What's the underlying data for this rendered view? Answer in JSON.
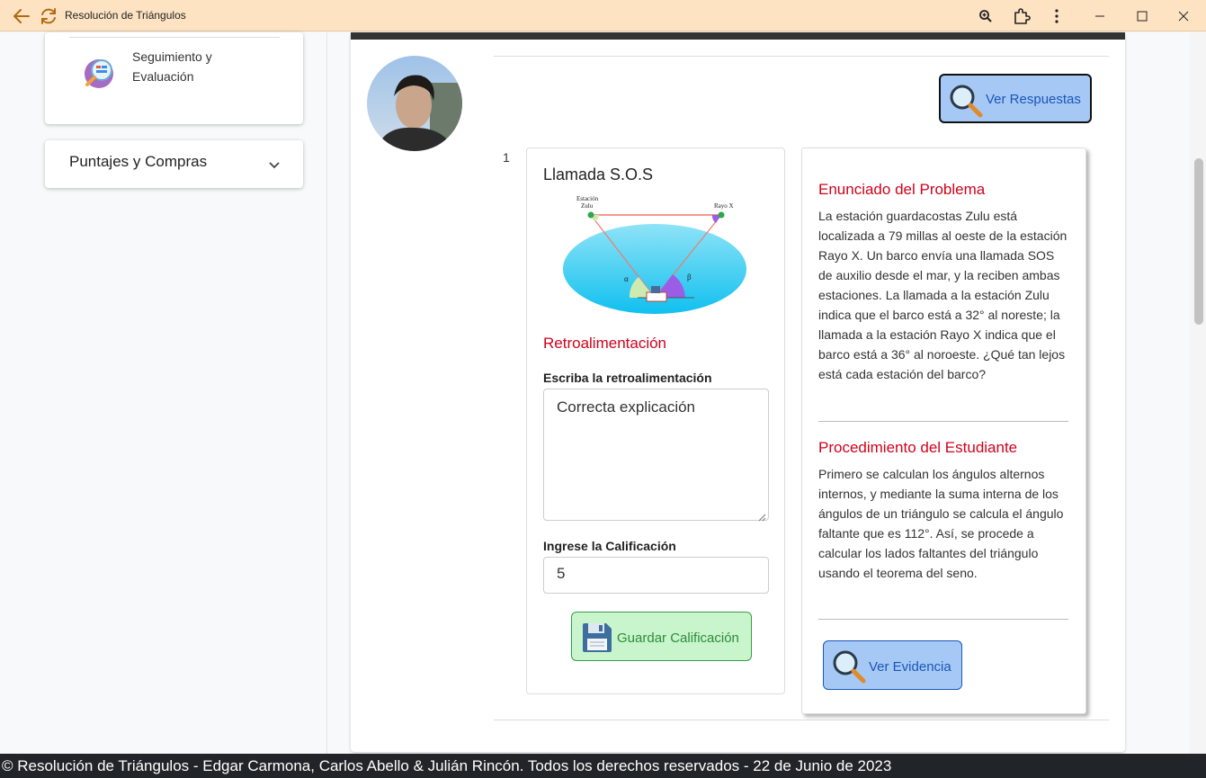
{
  "window": {
    "title": "Resolución de Triángulos",
    "back_icon": "arrow-left-icon",
    "refresh_icon": "refresh-icon",
    "zoom_icon": "zoom-icon",
    "extensions_icon": "puzzle-icon",
    "more_icon": "more-vertical-icon"
  },
  "sidebar": {
    "items": [
      {
        "label": "Seguimiento y Evaluación",
        "icon": "magnifier-chart-icon"
      }
    ],
    "accordion": {
      "label": "Puntajes y Compras",
      "expanded": false
    }
  },
  "main": {
    "ver_respuestas_label": "Ver Respuestas",
    "row_number": "1",
    "problem": {
      "title": "Llamada S.O.S",
      "diagram": {
        "left_station": "Estación Zulu",
        "right_station": "Rayo X",
        "alpha": "α",
        "beta": "β"
      }
    },
    "feedback": {
      "section_title": "Retroalimentación",
      "write_label": "Escriba la retroalimentación",
      "text": "Correcta explicación",
      "grade_label": "Ingrese la Calificación",
      "grade_value": "5",
      "save_label": "Guardar Calificación"
    },
    "statement": {
      "title": "Enunciado del Problema",
      "text": "La estación guardacostas Zulu está localizada a 79 millas al oeste de la estación Rayo X. Un barco envía una llamada SOS de auxilio desde el mar, y la reciben ambas estaciones. La llamada a la estación Zulu indica que el barco está a 32° al noreste; la llamada a la estación Rayo X indica que el barco está a 36° al noroeste. ¿Qué tan lejos está cada estación del barco?"
    },
    "procedure": {
      "title": "Procedimiento del Estudiante",
      "text": "Primero se calculan los ángulos alternos internos, y mediante la suma interna de los ángulos de un triángulo se calcula el ángulo faltante que es 112°. Así, se procede a calcular los lados faltantes del triángulo usando el teorema del seno."
    },
    "ver_evidencia_label": "Ver Evidencia"
  },
  "footer": {
    "text": "© Resolución de Triángulos - Edgar Carmona, Carlos Abello & Julián Rincón. Todos los derechos reservados - 22 de Junio de 2023"
  },
  "colors": {
    "titlebar": "#fde3c2",
    "accent_red": "#d0021b",
    "button_blue": "#a6c8f5",
    "button_green": "#c8f5cc",
    "footer": "#212529"
  }
}
